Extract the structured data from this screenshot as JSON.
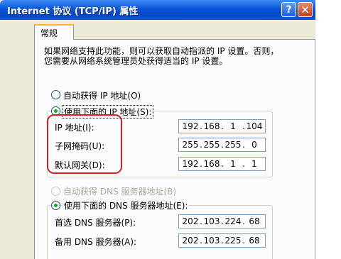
{
  "window": {
    "title": "Internet 协议 (TCP/IP) 属性"
  },
  "tabs": [
    "常规"
  ],
  "description": "如果网络支持此功能，则可以获取自动指派的 IP 设置。否则，您需要从网络系统管理员处获得适当的 IP 设置。",
  "ip": {
    "auto_label": "自动获得 IP 地址(O)",
    "manual_label": "使用下面的 IP 地址(S):",
    "fields": [
      {
        "label": "IP 地址(I):",
        "octets": [
          "192",
          "168",
          "1",
          "104"
        ]
      },
      {
        "label": "子网掩码(U):",
        "octets": [
          "255",
          "255",
          "255",
          "0"
        ]
      },
      {
        "label": "默认网关(D):",
        "octets": [
          "192",
          "168",
          "1",
          "1"
        ]
      }
    ]
  },
  "dns": {
    "auto_label": "自动获得 DNS 服务器地址(B)",
    "manual_label": "使用下面的 DNS 服务器地址(E):",
    "fields": [
      {
        "label": "首选 DNS 服务器(P):",
        "octets": [
          "202",
          "103",
          "224",
          "68"
        ]
      },
      {
        "label": "备用 DNS 服务器(A):",
        "octets": [
          "202",
          "103",
          "225",
          "68"
        ]
      }
    ]
  },
  "icons": {
    "help": "?",
    "close": "✕"
  },
  "colors": {
    "titlebar": "#0a55d8",
    "dialog_bg": "#ece9d8",
    "highlight_box": "#d62020",
    "radio_selected": "#21a121"
  }
}
